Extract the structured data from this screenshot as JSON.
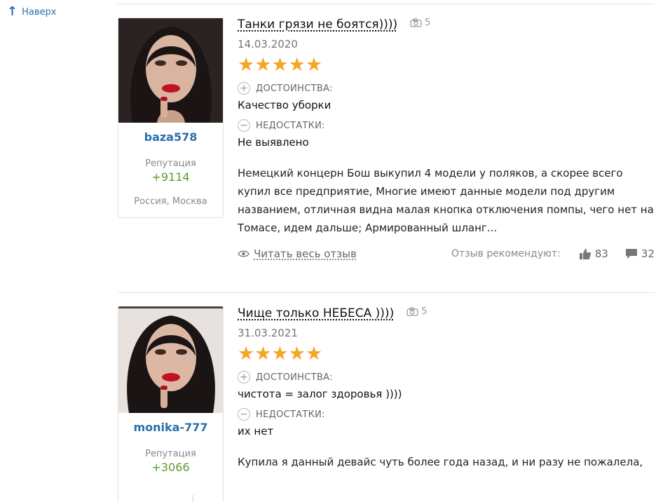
{
  "nav": {
    "back_to_top": "Наверх"
  },
  "reviews": [
    {
      "author": "baza578",
      "reputation_label": "Репутация",
      "reputation": "+9114",
      "location": "Россия, Москва",
      "title": "Танки грязи не боятся))))",
      "photo_count": "5",
      "date": "14.03.2020",
      "stars": "★★★★★",
      "pros_label": "ДОСТОИНСТВА:",
      "pros": "Качество уборки",
      "cons_label": "НЕДОСТАТКИ:",
      "cons": "Не выявлено",
      "text": "Немецкий концерн Бош выкупил 4 модели у поляков, а скорее всего купил все предприятие, Многие имеют данные модели под другим названием, отличная видна малая кнопка отключения помпы, чего нет на Томасе, идем дальше; Армированный шланг...",
      "read_more": "Читать весь отзыв",
      "recommend_label": "Отзыв рекомендуют:",
      "likes": "83",
      "comments": "32"
    },
    {
      "author": "monika-777",
      "reputation_label": "Репутация",
      "reputation": "+3066",
      "title": "Чище только НЕБЕСА ))))",
      "photo_count": "5",
      "date": "31.03.2021",
      "stars": "★★★★★",
      "pros_label": "ДОСТОИНСТВА:",
      "pros": "чистота = залог здоровья ))))",
      "cons_label": "НЕДОСТАТКИ:",
      "cons": "их нет",
      "text": "Купила я данный девайс чуть более года назад, и ни разу не пожалела,"
    }
  ],
  "colors": {
    "link": "#2a6fa8",
    "star": "#f5a623",
    "reputation": "#5b9a2f"
  },
  "icons": [
    "arrow-up-icon",
    "camera-icon",
    "plus-circle-icon",
    "minus-circle-icon",
    "eye-icon",
    "thumbs-up-icon",
    "comment-icon",
    "star-icon"
  ]
}
